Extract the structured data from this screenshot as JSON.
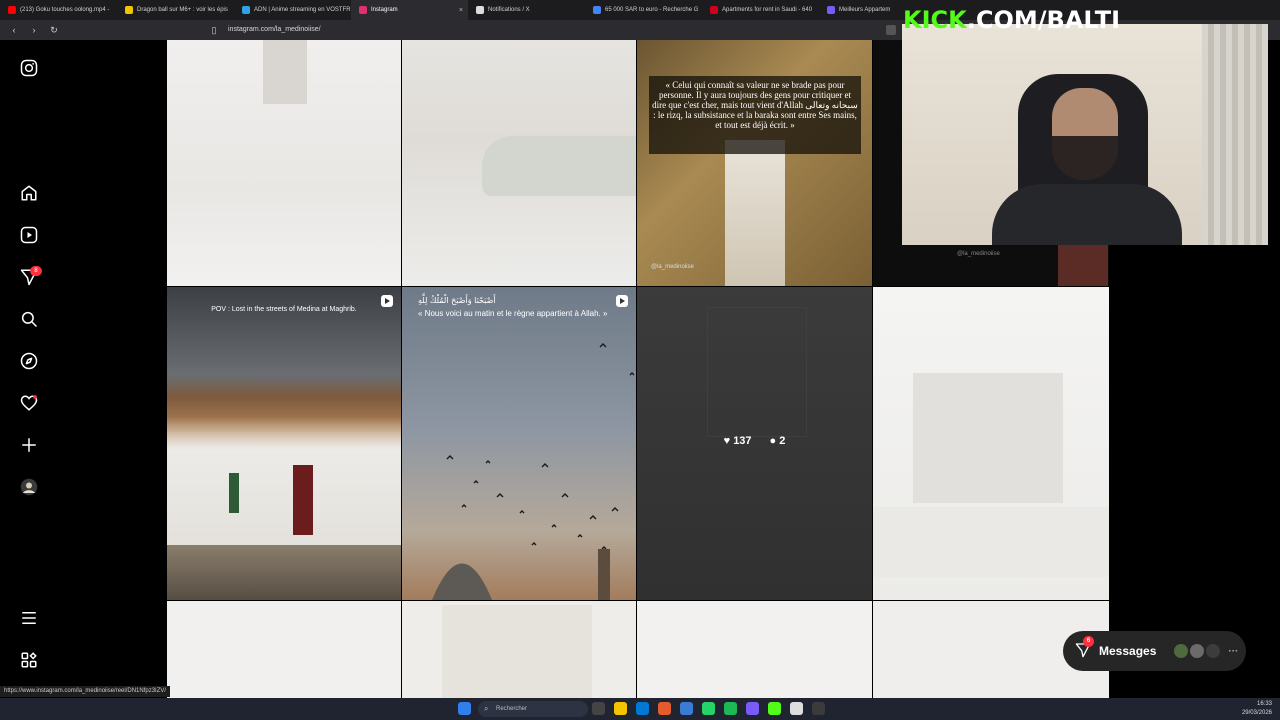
{
  "browser": {
    "tabs": [
      {
        "label": "(213) Goku touches oolong.mp4 -",
        "color": "#ff0000"
      },
      {
        "label": "Dragon ball sur M6+ : voir les épis",
        "color": "#f5c400"
      },
      {
        "label": "ADN | Anime streaming en VOSTFR",
        "color": "#2fa3e6"
      },
      {
        "label": "Instagram",
        "color": "#e1306c",
        "active": true
      },
      {
        "label": "Notifications / X",
        "color": "#dddddd"
      },
      {
        "label": "65 000 SAR to euro - Recherche G",
        "color": "#4285f4"
      },
      {
        "label": "Apartments for rent in Saudi - 640",
        "color": "#d0021b"
      },
      {
        "label": "Meilleurs Appartem",
        "color": "#7a5af8"
      }
    ],
    "url": "instagram.com/la_medinoiise/",
    "status_url": "https://www.instagram.com/la_medinoiise/reel/DN1Nfpz3IZV/"
  },
  "sidebar": {
    "notifications_badge": "8"
  },
  "posts": {
    "quote_text": "« Celui qui connaît sa valeur ne se brade pas pour personne. Il y aura toujours des gens pour critiquer et dire que c'est cher, mais tout vient d'Allah سبحانه وتعالى : le rizq, la subsistance et la baraka sont entre Ses mains, et tout est déjà écrit. »",
    "quote_handle": "@la_medinoiise",
    "quote_handle_2": "@la_medinoiise",
    "pov_text": "POV : Lost in the streets of Medina at Maghrib.",
    "arabic_text": "أَصْبَحْنَا وَأَصْبَحَ الْمُلْكُ لِلَّهِ",
    "morning_text": "« Nous voici au matin et le règne appartient à Allah. »",
    "likes": "137",
    "comments": "2"
  },
  "stream": {
    "kick_prefix": "KICK",
    "kick_suffix": ".COM/BALTI"
  },
  "messages": {
    "label": "Messages",
    "badge": "6"
  },
  "taskbar": {
    "search_placeholder": "Rechercher",
    "time": "16:33",
    "date": "29/03/2026"
  }
}
